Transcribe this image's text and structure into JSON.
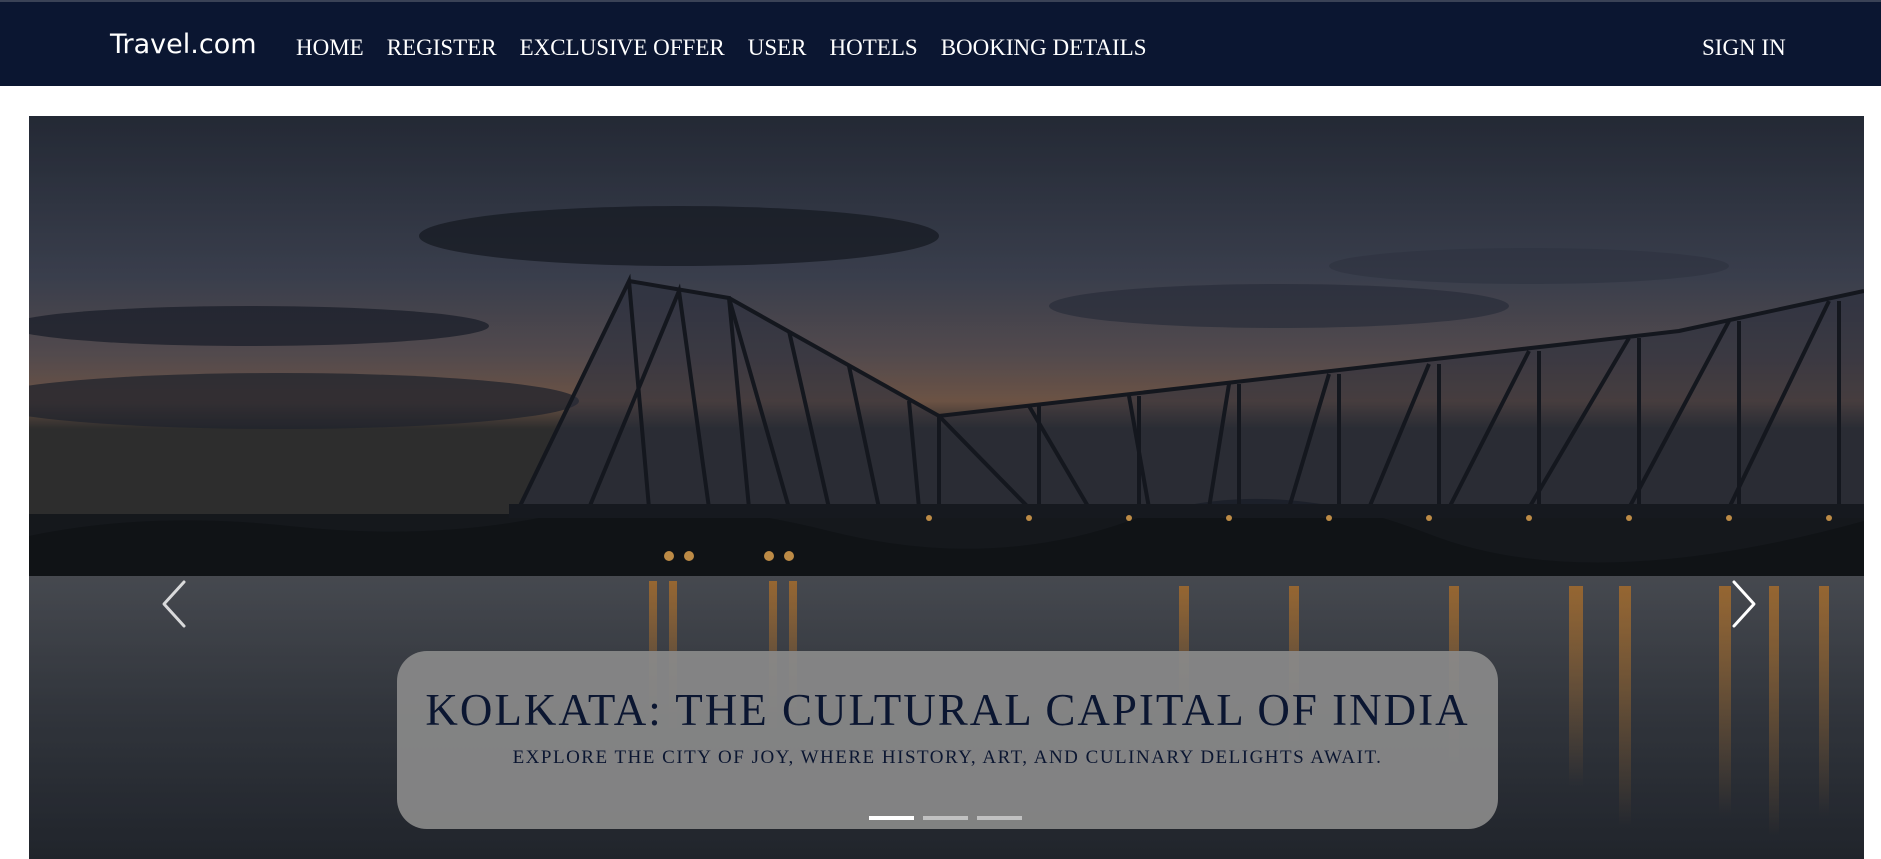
{
  "navbar": {
    "brand": "Travel.com",
    "links": [
      "HOME",
      "REGISTER",
      "EXCLUSIVE OFFER",
      "USER",
      "HOTELS",
      "BOOKING DETAILS"
    ],
    "signin_label": "SIGN IN",
    "background_color": "#0b1631"
  },
  "carousel": {
    "slide": {
      "title": "KOLKATA: THE CULTURAL CAPITAL OF INDIA",
      "subtitle": "EXPLORE THE CITY OF JOY, WHERE HISTORY, ART, AND CULINARY DELIGHTS AWAIT."
    },
    "prev_icon": "chevron-left-icon",
    "next_icon": "chevron-right-icon",
    "indicator_count": 3,
    "active_indicator": 1
  }
}
